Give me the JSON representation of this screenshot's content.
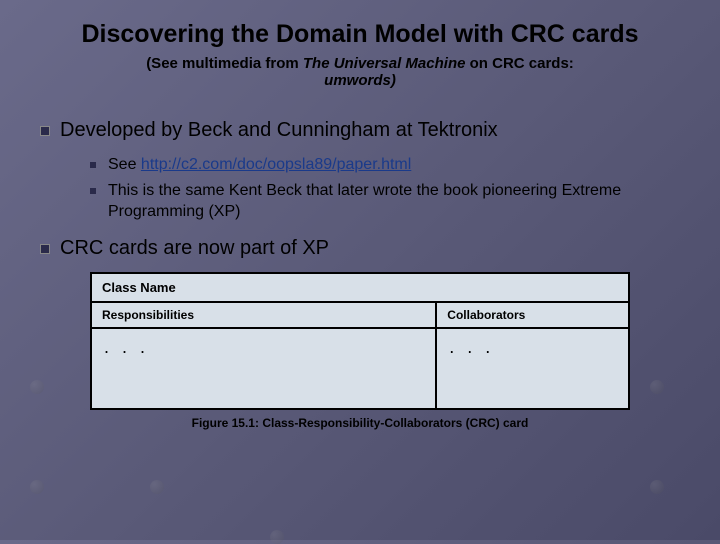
{
  "title": "Discovering the Domain Model with CRC cards",
  "subtitle_prefix": "(See multimedia from ",
  "subtitle_italic": "The Universal Machine",
  "subtitle_suffix": " on CRC cards:",
  "subtitle_line2": "umwords)",
  "bullets": {
    "main1": "Developed by Beck and Cunningham at Tektronix",
    "sub1_prefix": "See ",
    "sub1_link": "http://c2.com/doc/oopsla89/paper.html",
    "sub2": "This is the same Kent Beck that later wrote the book pioneering Extreme Programming (XP)",
    "main2": "CRC cards are now part of XP"
  },
  "card": {
    "classname": "Class Name",
    "responsibilities": "Responsibilities",
    "collaborators": "Collaborators",
    "ellipsis": ". . ."
  },
  "figure_caption": "Figure 15.1: Class-Responsibility-Collaborators (CRC) card"
}
